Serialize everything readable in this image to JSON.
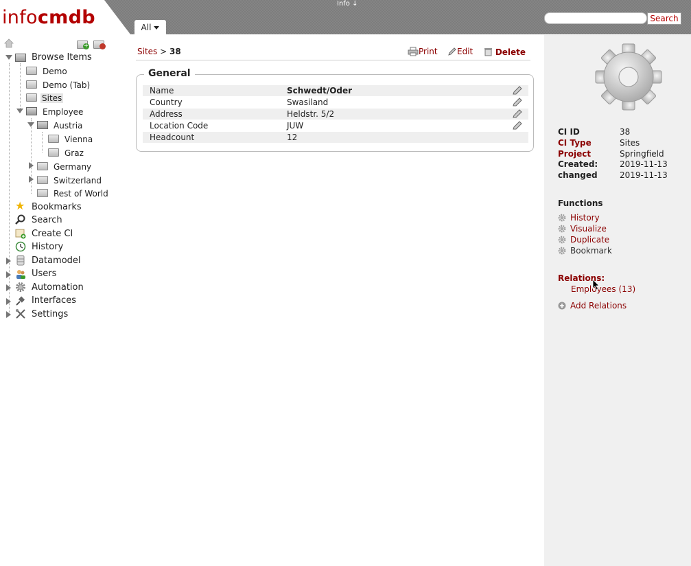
{
  "header": {
    "logo_thin": "info",
    "logo_bold": "cmdb",
    "info_label": "Info",
    "tab_label": "All",
    "search_placeholder": "",
    "search_button": "Search"
  },
  "tree": {
    "browse_items": "Browse Items",
    "demo": "Demo",
    "demo_tab": "Demo (Tab)",
    "sites": "Sites",
    "employee": "Employee",
    "austria": "Austria",
    "vienna": "Vienna",
    "graz": "Graz",
    "germany": "Germany",
    "switzerland": "Switzerland",
    "rest_of_world": "Rest of World",
    "bookmarks": "Bookmarks",
    "search": "Search",
    "create_ci": "Create CI",
    "history": "History",
    "datamodel": "Datamodel",
    "users": "Users",
    "automation": "Automation",
    "interfaces": "Interfaces",
    "settings": "Settings"
  },
  "main": {
    "breadcrumb_link": "Sites",
    "breadcrumb_sep": ">",
    "breadcrumb_current": "38",
    "print": "Print",
    "edit": "Edit",
    "delete": "Delete",
    "group_title": "General",
    "attributes": [
      {
        "key": "Name",
        "value": "Schwedt/Oder"
      },
      {
        "key": "Country",
        "value": "Swasiland"
      },
      {
        "key": "Address",
        "value": "Heldstr. 5/2"
      },
      {
        "key": "Location Code",
        "value": "JUW"
      },
      {
        "key": "Headcount",
        "value": "12"
      }
    ]
  },
  "side": {
    "ci_id_label": "CI ID",
    "ci_id": "38",
    "ci_type_label": "CI Type",
    "ci_type": "Sites",
    "project_label": "Project",
    "project": "Springfield",
    "created_label": "Created:",
    "created": "2019-11-13",
    "changed_label": "changed",
    "changed": "2019-11-13",
    "functions_title": "Functions",
    "fn_history": "History",
    "fn_visualize": "Visualize",
    "fn_duplicate": "Duplicate",
    "fn_bookmark": "Bookmark",
    "relations_title": "Relations:",
    "relation_employees": "Employees (13)",
    "add_relations": "Add Relations"
  },
  "colors": {
    "accent": "#8b0000",
    "logo": "#b30000",
    "header_bg": "#7d7d7d",
    "side_bg": "#f0f0f0"
  }
}
